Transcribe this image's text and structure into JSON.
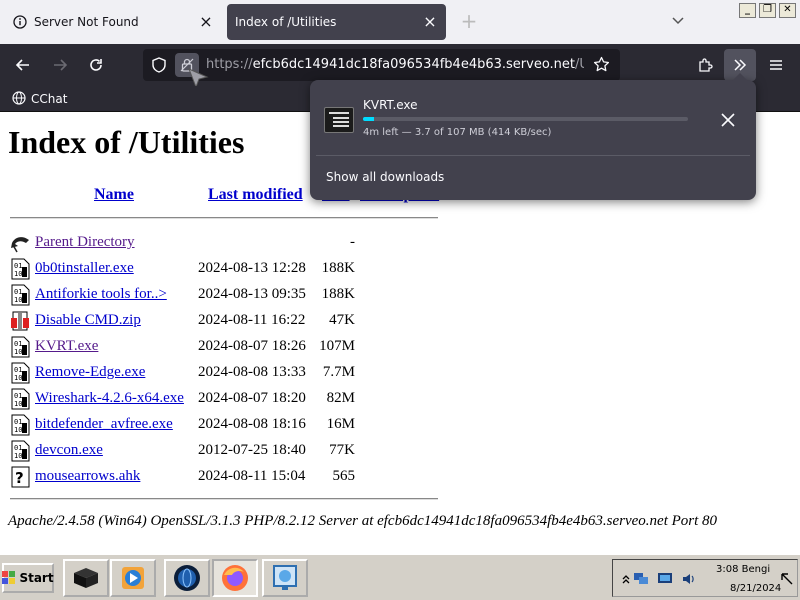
{
  "tabs": [
    {
      "title": "Server Not Found",
      "icon": "info-icon"
    },
    {
      "title": "Index of /Utilities",
      "icon": "none"
    }
  ],
  "window_controls": {
    "minimize": "_",
    "maximize": "❐",
    "close": "✕"
  },
  "url": {
    "prefix": "https://",
    "host": "efcb6dc14941dc18fa096534fb4e4b63.serveo.net",
    "path": "/Utilities/"
  },
  "bookmarks": [
    {
      "label": "CChat",
      "icon": "globe-icon"
    }
  ],
  "page": {
    "title": "Index of /Utilities",
    "columns": [
      "Name",
      "Last modified",
      "Size",
      "Description"
    ],
    "entries": [
      {
        "name": "Parent Directory",
        "date": "",
        "size": "-",
        "icon": "back-icon",
        "visited": true
      },
      {
        "name": "0b0tinstaller.exe",
        "date": "2024-08-13 12:28",
        "size": "188K",
        "icon": "binary-file-icon",
        "visited": false
      },
      {
        "name": "Antiforkie tools for..>",
        "date": "2024-08-13 09:35",
        "size": "188K",
        "icon": "binary-file-icon",
        "visited": false
      },
      {
        "name": "Disable CMD.zip",
        "date": "2024-08-11 16:22",
        "size": "47K",
        "icon": "compressed-file-icon",
        "visited": false
      },
      {
        "name": "KVRT.exe",
        "date": "2024-08-07 18:26",
        "size": "107M",
        "icon": "binary-file-icon",
        "visited": true
      },
      {
        "name": "Remove-Edge.exe",
        "date": "2024-08-08 13:33",
        "size": "7.7M",
        "icon": "binary-file-icon",
        "visited": false
      },
      {
        "name": "Wireshark-4.2.6-x64.exe",
        "date": "2024-08-07 18:20",
        "size": "82M",
        "icon": "binary-file-icon",
        "visited": false
      },
      {
        "name": "bitdefender_avfree.exe",
        "date": "2024-08-08 18:16",
        "size": "16M",
        "icon": "binary-file-icon",
        "visited": false
      },
      {
        "name": "devcon.exe",
        "date": "2012-07-25 18:40",
        "size": "77K",
        "icon": "binary-file-icon",
        "visited": false
      },
      {
        "name": "mousearrows.ahk",
        "date": "2024-08-11 15:04",
        "size": "565",
        "icon": "unknown-file-icon",
        "visited": false
      }
    ],
    "server_signature": "Apache/2.4.58 (Win64) OpenSSL/3.1.3 PHP/8.2.12 Server at efcb6dc14941dc18fa096534fb4e4b63.serveo.net Port 80"
  },
  "downloads": {
    "filename": "KVRT.exe",
    "status": "4m left — 3.7 of 107 MB (414 KB/sec)",
    "progress": 0.035,
    "show_all_label": "Show all downloads"
  },
  "taskbar": {
    "start_label": "Start",
    "apps": [
      "terminal-app-icon",
      "media-player-app-icon",
      "globe-app-icon",
      "firefox-app-icon",
      "magnifier-app-icon"
    ],
    "active_app": "firefox-app-icon",
    "clock_time": "3:08 Bengi",
    "clock_date": "8/21/2024"
  },
  "colors": {
    "accent": "#00ddff",
    "link": "#0000cc",
    "visited": "#551a8b",
    "toolbar": "#2b2a33"
  }
}
